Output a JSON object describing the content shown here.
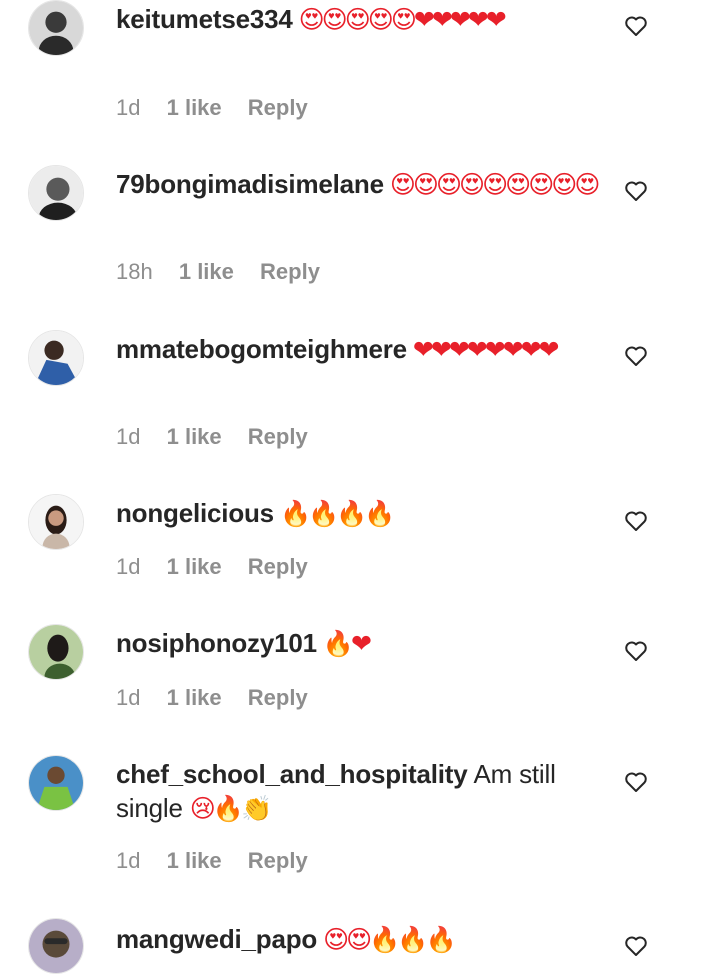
{
  "comments": [
    {
      "username": "keitumetse334",
      "text": "",
      "emoji": "😍😍😍😍😍❤❤❤❤❤",
      "time": "1d",
      "likes": "1 like",
      "reply": "Reply",
      "avatar_color": "#3a3a3a"
    },
    {
      "username": "79bongimadisimelane",
      "text": "",
      "emoji": "😍😍😍😍😍😍😍😍😍",
      "time": "18h",
      "likes": "1 like",
      "reply": "Reply",
      "avatar_color": "#6b6b6b"
    },
    {
      "username": "mmatebogomteighmere",
      "text": "",
      "emoji": "❤❤❤❤❤❤❤❤",
      "time": "1d",
      "likes": "1 like",
      "reply": "Reply",
      "avatar_color": "#2f5fa8"
    },
    {
      "username": "nongelicious",
      "text": "",
      "emoji": "🔥🔥🔥🔥",
      "time": "1d",
      "likes": "1 like",
      "reply": "Reply",
      "avatar_color": "#c9b7a8"
    },
    {
      "username": "nosiphonozy101",
      "text": "",
      "emoji": "🔥❤",
      "time": "1d",
      "likes": "1 like",
      "reply": "Reply",
      "avatar_color": "#3d5f2f"
    },
    {
      "username": "chef_school_and_hospitality",
      "text": "Am still single",
      "emoji": "😢🔥👏",
      "time": "1d",
      "likes": "1 like",
      "reply": "Reply",
      "avatar_color": "#4a90c8"
    },
    {
      "username": "mangwedi_papo",
      "text": "",
      "emoji": "😍😍🔥🔥🔥",
      "time": "",
      "likes": "",
      "reply": "",
      "avatar_color": "#8a7fa0"
    }
  ],
  "icons": {
    "like": "heart-outline-icon"
  }
}
